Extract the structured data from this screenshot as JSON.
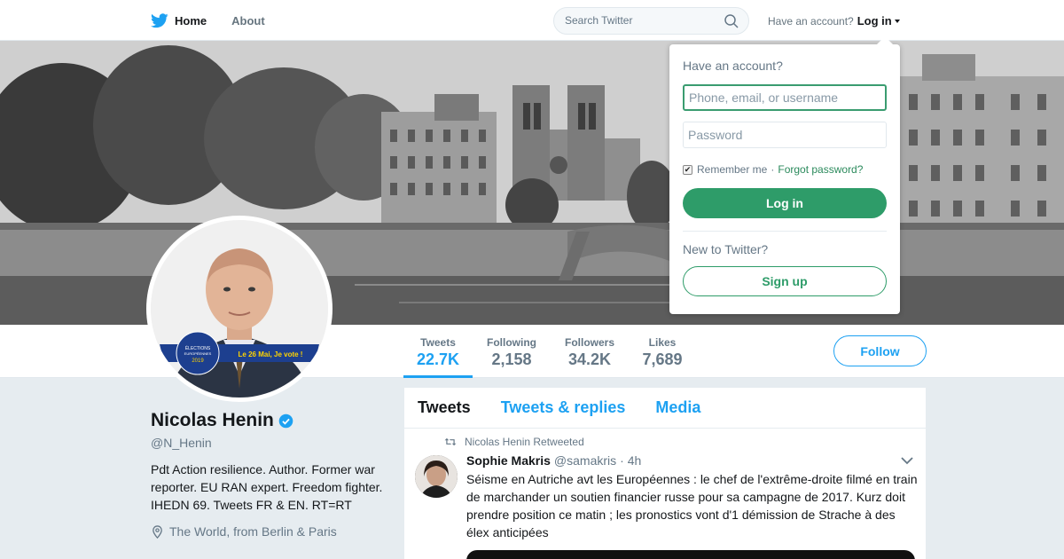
{
  "nav": {
    "home_label": "Home",
    "about_label": "About",
    "search_placeholder": "Search Twitter",
    "have_account_text": "Have an account?",
    "login_label": "Log in"
  },
  "profile": {
    "name": "Nicolas Henin",
    "handle": "@N_Henin",
    "bio": "Pdt Action resilience. Author. Former war reporter. EU RAN expert. Freedom fighter. IHEDN 69. Tweets FR & EN. RT=RT",
    "location": "The World, from Berlin & Paris",
    "avatar_badge": {
      "line1": "ÉLECTIONS",
      "line2": "EUROPÉENNES",
      "year": "2019",
      "banner_text": "Le 26 Mai, Je vote !"
    }
  },
  "stats": [
    {
      "label": "Tweets",
      "value": "22.7K"
    },
    {
      "label": "Following",
      "value": "2,158"
    },
    {
      "label": "Followers",
      "value": "34.2K"
    },
    {
      "label": "Likes",
      "value": "7,689"
    }
  ],
  "follow_label": "Follow",
  "timeline": {
    "tabs": [
      "Tweets",
      "Tweets & replies",
      "Media"
    ],
    "tweet": {
      "retweet_context": "Nicolas Henin Retweeted",
      "author_name": "Sophie Makris",
      "author_handle": "@samakris",
      "time": "· 4h",
      "text": "Séisme en Autriche avt les Européennes : le chef de l'extrême-droite filmé en train de marchander un soutien financier russe pour sa campagne de 2017. Kurz doit prendre position ce matin ; les pronostics vont d'1 démission de Strache à des élex anticipées"
    }
  },
  "login_dropdown": {
    "heading": "Have an account?",
    "username_placeholder": "Phone, email, or username",
    "password_placeholder": "Password",
    "remember_label": "Remember me",
    "separator": "·",
    "forgot_label": "Forgot password?",
    "login_button": "Log in",
    "new_text": "New to Twitter?",
    "signup_button": "Sign up",
    "remember_checked": true
  },
  "colors": {
    "brand_blue": "#1da1f2",
    "login_green": "#2e9c69",
    "text_gray": "#657786"
  }
}
